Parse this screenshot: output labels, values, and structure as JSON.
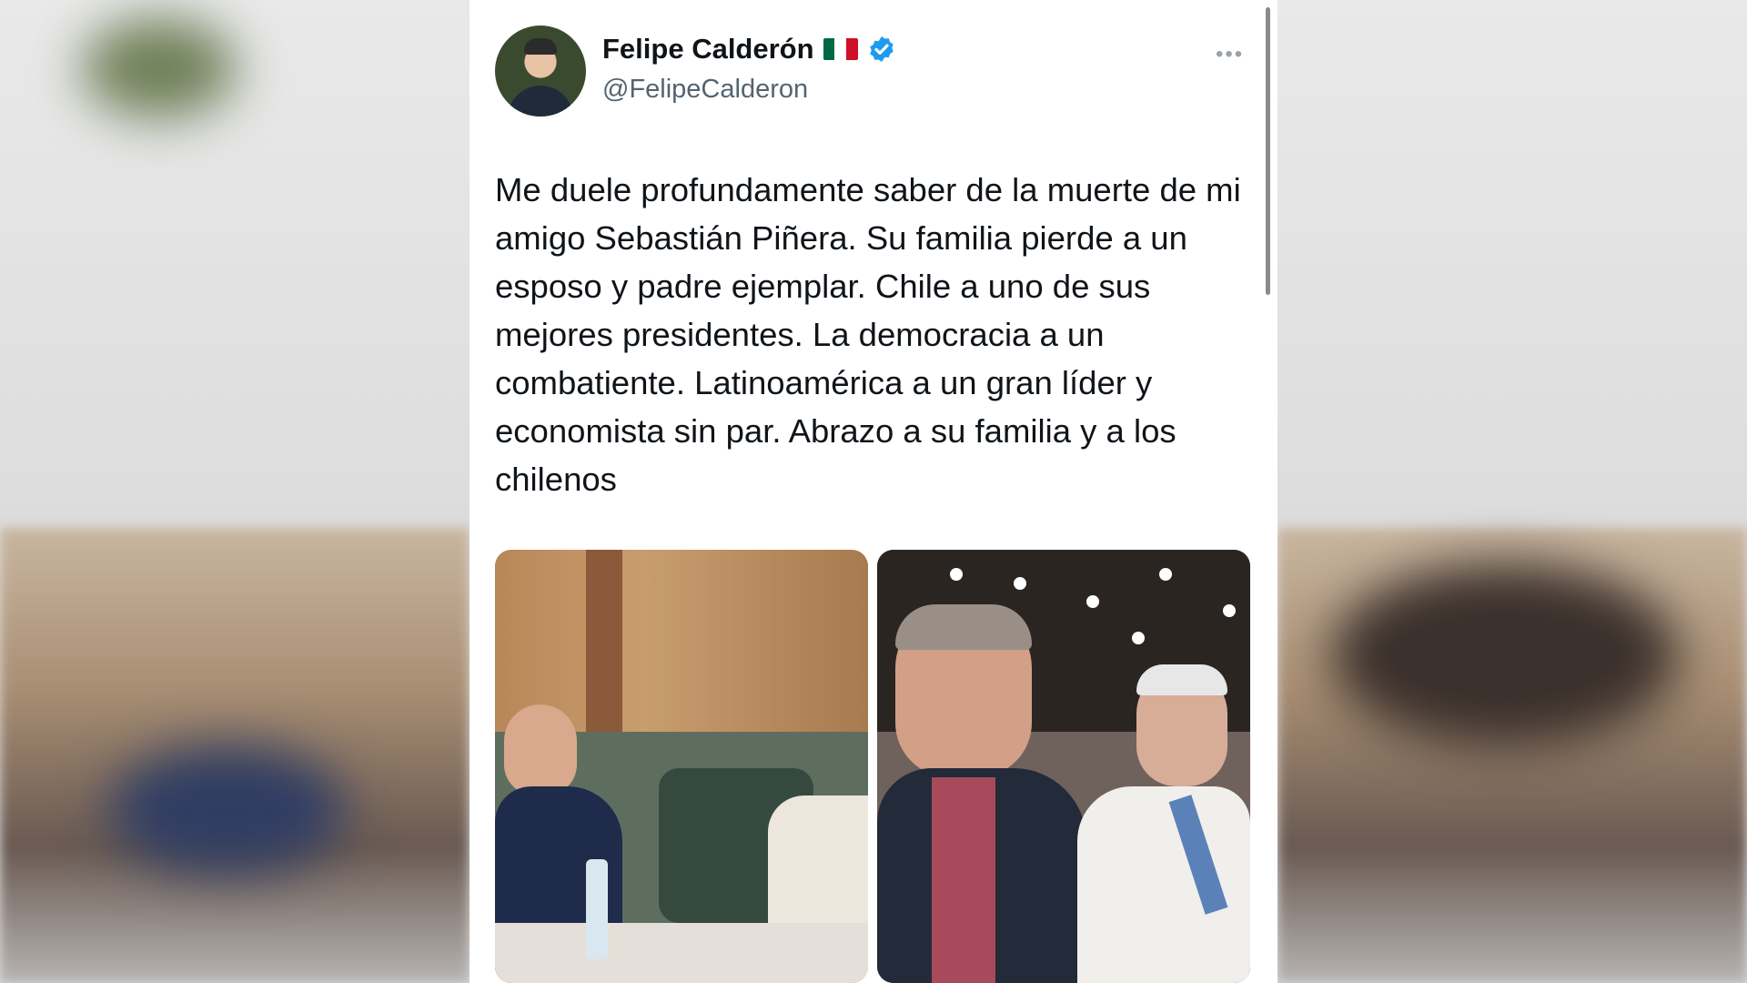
{
  "tweet": {
    "author_name": "Felipe Calderón",
    "author_handle": "@FelipeCalderon",
    "flag_icon": "mexico-flag-icon",
    "verified_icon": "verified-badge-icon",
    "more_icon": "more-options-icon",
    "text": "Me duele profundamente saber de la muerte de mi amigo Sebastián Piñera. Su familia pierde a un esposo y padre ejemplar. Chile a uno de sus mejores presidentes. La democracia a un combatiente. Latinoamérica a un gran líder y economista sin par. Abrazo a su familia y a los chilenos",
    "media": [
      {
        "name": "photo-meeting"
      },
      {
        "name": "photo-selfie"
      }
    ]
  },
  "colors": {
    "verified": "#1d9bf0",
    "text": "#0f1419",
    "secondary": "#536471"
  }
}
